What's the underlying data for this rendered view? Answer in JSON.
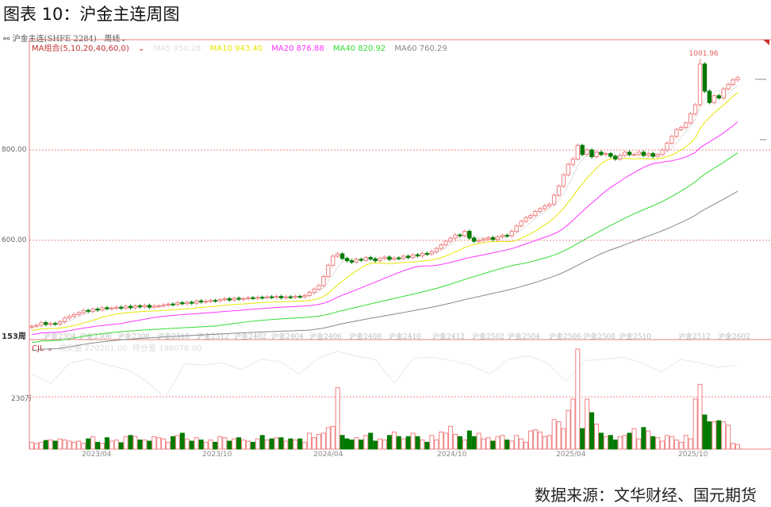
{
  "title": "图表 10：沪金主连周图",
  "header": {
    "symbol": "沪金主连(SHFE 2284)",
    "period": "周线"
  },
  "ma_legend": {
    "group": "MA组合(5,10,20,40,60,0)",
    "items": [
      {
        "label": "MA5 950.28",
        "color": "#e0e0e0"
      },
      {
        "label": "MA10 943.40",
        "color": "#e6e600"
      },
      {
        "label": "MA20 876.88",
        "color": "#ff33ff"
      },
      {
        "label": "MA40 820.92",
        "color": "#33dd33"
      },
      {
        "label": "MA60 760.29",
        "color": "#888888"
      }
    ]
  },
  "bar_count_label": "153周",
  "vol_legend": {
    "indicator": "CJL",
    "volume": "成交量 220201.00",
    "oi": "持仓量 198078.00"
  },
  "vol_axis_label": "230万",
  "footer": "数据来源：文华财经、国元期货",
  "colors": {
    "up": "#f08080",
    "down": "#007a00",
    "axis": "#e88080"
  },
  "chart_data": [
    {
      "type": "candlestick",
      "title": "沪金主连(SHFE 2284) 周线",
      "y_ticks": [
        "800.00",
        "600.00"
      ],
      "ylim": [
        391,
        1044
      ],
      "x_tick_labels": [
        "沪金2304",
        "沪金2306",
        "沪金2308",
        "沪金2310",
        "沪金2312",
        "沪金2402",
        "沪金2404",
        "沪金2406",
        "沪金2408",
        "沪金2410",
        "沪金2412",
        "沪金2502",
        "沪金2504",
        "沪金2506",
        "沪金2508",
        "沪金2510",
        "沪金2512",
        "沪金2602"
      ],
      "peak_label": "1001.96",
      "close": [
        410,
        412,
        418,
        414,
        416,
        415,
        420,
        428,
        432,
        436,
        440,
        445,
        443,
        448,
        446,
        451,
        449,
        450,
        452,
        450,
        454,
        451,
        455,
        453,
        456,
        452,
        455,
        455,
        457,
        459,
        458,
        462,
        460,
        463,
        461,
        466,
        464,
        465,
        467,
        466,
        469,
        471,
        468,
        472,
        470,
        471,
        473,
        472,
        474,
        473,
        475,
        474,
        476,
        473,
        475,
        474,
        476,
        475,
        478,
        485,
        492,
        500,
        520,
        545,
        565,
        570,
        560,
        555,
        552,
        558,
        556,
        562,
        559,
        555,
        560,
        563,
        558,
        561,
        560,
        565,
        562,
        568,
        566,
        571,
        570,
        575,
        582,
        590,
        598,
        605,
        612,
        610,
        620,
        605,
        598,
        600,
        603,
        606,
        602,
        608,
        611,
        610,
        620,
        632,
        642,
        650,
        655,
        664,
        670,
        676,
        680,
        700,
        720,
        745,
        768,
        780,
        810,
        790,
        800,
        785,
        795,
        790,
        792,
        786,
        780,
        788,
        795,
        790,
        790,
        795,
        788,
        792,
        786,
        790,
        800,
        815,
        830,
        845,
        850,
        860,
        880,
        900,
        990,
        930,
        905,
        920,
        915,
        935,
        945,
        955,
        960
      ],
      "ma_periods": [
        5,
        10,
        20,
        40,
        60
      ]
    },
    {
      "type": "bar",
      "name": "CJL",
      "unit": "万",
      "ylim": [
        0,
        440
      ],
      "reference_line": 230,
      "x_date_labels": [
        "2023/04",
        "2023/10",
        "2024/04",
        "2024/10",
        "2025/04",
        "2025/10"
      ],
      "volume": [
        30,
        25,
        30,
        38,
        40,
        35,
        45,
        40,
        35,
        30,
        35,
        25,
        45,
        55,
        30,
        25,
        50,
        35,
        40,
        28,
        55,
        60,
        55,
        40,
        40,
        35,
        55,
        50,
        45,
        30,
        55,
        60,
        70,
        45,
        35,
        50,
        40,
        30,
        40,
        30,
        55,
        50,
        35,
        45,
        50,
        40,
        35,
        30,
        45,
        60,
        40,
        45,
        50,
        50,
        35,
        45,
        40,
        45,
        30,
        70,
        50,
        65,
        70,
        95,
        100,
        270,
        60,
        45,
        40,
        50,
        40,
        60,
        70,
        35,
        45,
        40,
        60,
        75,
        55,
        45,
        55,
        70,
        55,
        40,
        30,
        60,
        40,
        75,
        70,
        100,
        65,
        55,
        40,
        80,
        55,
        70,
        45,
        50,
        35,
        55,
        60,
        40,
        35,
        60,
        45,
        30,
        80,
        85,
        75,
        55,
        60,
        130,
        120,
        90,
        170,
        220,
        440,
        90,
        220,
        160,
        110,
        70,
        55,
        60,
        40,
        55,
        60,
        70,
        90,
        45,
        95,
        80,
        55,
        50,
        35,
        60,
        55,
        40,
        30,
        60,
        45,
        220,
        285,
        150,
        120,
        120,
        125,
        120,
        105,
        25,
        20
      ],
      "open_interest_every_4w": [
        330,
        290,
        380,
        395,
        370,
        350,
        300,
        225,
        375,
        370,
        380,
        350,
        395,
        385,
        330,
        400,
        430,
        410,
        395,
        290,
        400,
        405,
        390,
        370,
        330,
        395,
        410,
        380,
        300,
        390,
        395,
        405,
        380,
        340,
        395,
        380,
        360,
        370
      ]
    }
  ]
}
